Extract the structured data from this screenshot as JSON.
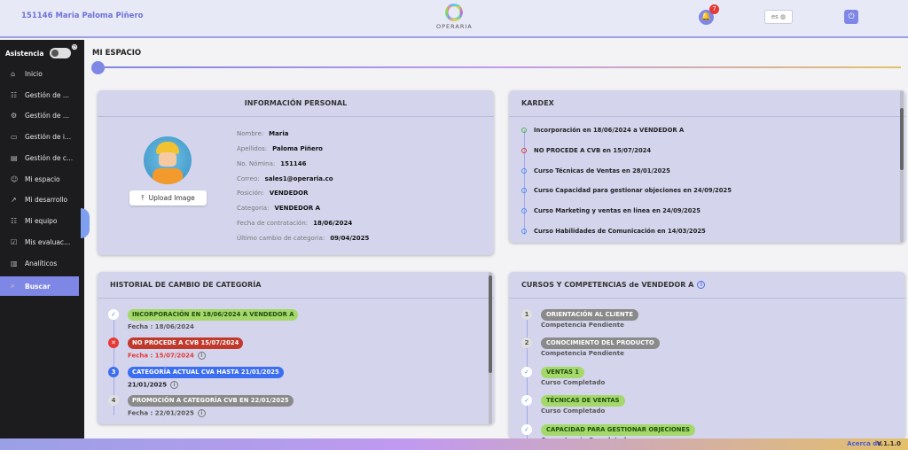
{
  "header": {
    "user": "151146 Maria Paloma Piñero",
    "logo_text": "OPERARIA",
    "notifications": "7",
    "lang": "es"
  },
  "sidebar": {
    "asistencia": "Asistencia",
    "items": [
      {
        "label": "Inicio",
        "icon": "home-icon"
      },
      {
        "label": "Gestión de ...",
        "icon": "users-icon"
      },
      {
        "label": "Gestión de ...",
        "icon": "user-gear-icon"
      },
      {
        "label": "Gestión de i...",
        "icon": "folder-icon"
      },
      {
        "label": "Gestión de c...",
        "icon": "document-icon"
      },
      {
        "label": "Mi espacio",
        "icon": "person-icon"
      },
      {
        "label": "Mi desarrollo",
        "icon": "growth-icon"
      },
      {
        "label": "Mi equipo",
        "icon": "team-icon"
      },
      {
        "label": "Mis evaluac...",
        "icon": "evaluation-icon"
      },
      {
        "label": "Analíticos",
        "icon": "chart-icon"
      },
      {
        "label": "Buscar",
        "icon": "search-icon"
      }
    ]
  },
  "page": {
    "title": "MI ESPACIO"
  },
  "personal": {
    "title": "INFORMACIÓN PERSONAL",
    "upload": "Upload Image",
    "fields": [
      {
        "k": "Nombre:",
        "v": "Maria"
      },
      {
        "k": "Apellidos:",
        "v": "Paloma Piñero"
      },
      {
        "k": "No. Nómina:",
        "v": "151146"
      },
      {
        "k": "Correo:",
        "v": "sales1@operaria.co"
      },
      {
        "k": "Posición:",
        "v": "VENDEDOR"
      },
      {
        "k": "Categoria:",
        "v": "VENDEDOR A"
      },
      {
        "k": "Fecha de contratación:",
        "v": "18/06/2024"
      },
      {
        "k": "Último cambio de categoria:",
        "v": "09/04/2025"
      }
    ]
  },
  "kardex": {
    "title": "KARDEX",
    "items": [
      {
        "text": "Incorporación en 18/06/2024 a VENDEDOR A",
        "color": "#4caf50"
      },
      {
        "text": "NO PROCEDE A CVB en 15/07/2024",
        "color": "#e53935"
      },
      {
        "text": "Curso Técnicas de Ventas en 28/01/2025",
        "color": "#4b8ef0"
      },
      {
        "text": "Curso Capacidad para gestionar objeciones en 24/09/2025",
        "color": "#4b8ef0"
      },
      {
        "text": "Curso Marketing y ventas en linea en 24/09/2025",
        "color": "#4b8ef0"
      },
      {
        "text": "Curso Habilidades de Comunicación en 14/03/2025",
        "color": "#4b8ef0"
      }
    ]
  },
  "history": {
    "title": "HISTORIAL DE CAMBIO DE CATEGORÍA",
    "items": [
      {
        "badge": "✓",
        "pill": "INCORPORACIÓN EN 18/06/2024 A VENDEDOR A",
        "date": "Fecha : 18/06/2024",
        "pill_bg": "#a5d86a",
        "pill_fg": "#1f4d0f",
        "badge_bg": "#ffffff",
        "badge_fg": "#4b8ef0",
        "date_color": "#555"
      },
      {
        "badge": "✕",
        "pill": "NO PROCEDE A CVB 15/07/2024",
        "date": "Fecha : 15/07/2024",
        "pill_bg": "#c0392b",
        "pill_fg": "#ffffff",
        "badge_bg": "#e53935",
        "badge_fg": "#ffffff",
        "date_color": "#e53935"
      },
      {
        "badge": "3",
        "pill": "CATEGORÍA ACTUAL CVA HASTA 21/01/2025",
        "date": "21/01/2025",
        "pill_bg": "#3b6ef0",
        "pill_fg": "#ffffff",
        "badge_bg": "#3b6ef0",
        "badge_fg": "#ffffff",
        "date_color": "#222"
      },
      {
        "badge": "4",
        "pill": "PROMOCIÓN A CATEGORÍA CVB EN 22/01/2025",
        "date": "Fecha : 22/01/2025",
        "pill_bg": "#8a8a8a",
        "pill_fg": "#ffffff",
        "badge_bg": "#e0e0e0",
        "badge_fg": "#555",
        "date_color": "#555"
      }
    ]
  },
  "competencias": {
    "title": "CURSOS Y COMPETENCIAS de VENDEDOR A",
    "items": [
      {
        "badge": "1",
        "pill": "ORIENTACIÓN AL CLIENTE",
        "status": "Competencia Pendiente",
        "pill_bg": "#8a8a8a",
        "badge_bg": "#e0e0e0",
        "badge_fg": "#555"
      },
      {
        "badge": "2",
        "pill": "CONOCIMIENTO DEL PRODUCTO",
        "status": "Competencia Pendiente",
        "pill_bg": "#8a8a8a",
        "badge_bg": "#e0e0e0",
        "badge_fg": "#555"
      },
      {
        "badge": "✓",
        "pill": "VENTAS 1",
        "status": "Curso Completado",
        "pill_bg": "#a5d86a",
        "badge_bg": "#ffffff",
        "badge_fg": "#4b8ef0"
      },
      {
        "badge": "✓",
        "pill": "TÉCNICAS DE VENTAS",
        "status": "Curso Completado",
        "pill_bg": "#a5d86a",
        "badge_bg": "#ffffff",
        "badge_fg": "#4b8ef0"
      },
      {
        "badge": "✓",
        "pill": "CAPACIDAD PARA GESTIONAR OBJECIONES",
        "status": "Competencia Completada",
        "pill_bg": "#a5d86a",
        "badge_bg": "#ffffff",
        "badge_fg": "#4b8ef0"
      }
    ]
  },
  "footer": {
    "about": "Acerca de",
    "version": "V.1.1.0"
  }
}
